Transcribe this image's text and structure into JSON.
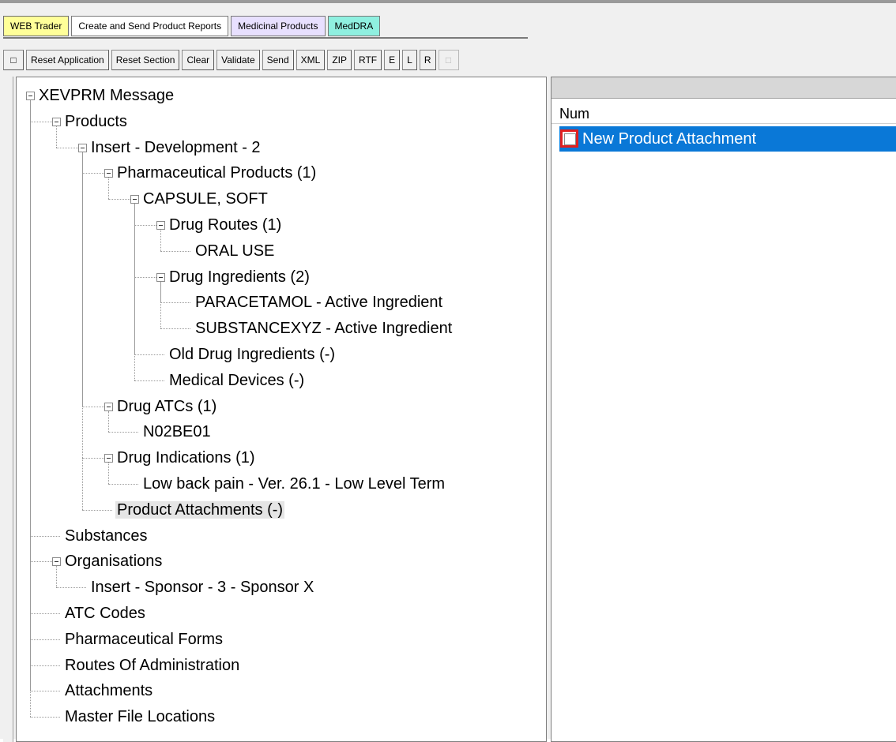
{
  "tabs": [
    {
      "label": "WEB Trader",
      "style": "yellow"
    },
    {
      "label": "Create and Send Product Reports",
      "style": "white"
    },
    {
      "label": "Medicinal Products",
      "style": "lav"
    },
    {
      "label": "MedDRA",
      "style": "teal"
    }
  ],
  "toolbar": {
    "checkbox_glyph": "□",
    "reset_application": "Reset Application",
    "reset_section": "Reset Section",
    "clear": "Clear",
    "validate": "Validate",
    "send": "Send",
    "xml": "XML",
    "zip": "ZIP",
    "rtf": "RTF",
    "e": "E",
    "l": "L",
    "r": "R",
    "disabled_glyph": "□"
  },
  "tree": {
    "nodes": [
      {
        "label": "XEVPRM Message",
        "level": 0,
        "expanded": true
      },
      {
        "label": "Products",
        "level": 1,
        "expanded": true
      },
      {
        "label": "Insert - Development - 2",
        "level": 2,
        "expanded": true
      },
      {
        "label": "Pharmaceutical Products (1)",
        "level": 3,
        "expanded": true
      },
      {
        "label": "CAPSULE, SOFT",
        "level": 4,
        "expanded": true
      },
      {
        "label": "Drug Routes (1)",
        "level": 5,
        "expanded": true
      },
      {
        "label": "ORAL USE",
        "level": 6
      },
      {
        "label": "Drug Ingredients (2)",
        "level": 5,
        "expanded": true
      },
      {
        "label": "PARACETAMOL - Active Ingredient",
        "level": 6
      },
      {
        "label": "SUBSTANCEXYZ - Active Ingredient",
        "level": 6
      },
      {
        "label": "Old Drug Ingredients (-)",
        "level": 5
      },
      {
        "label": "Medical Devices (-)",
        "level": 5
      },
      {
        "label": "Drug ATCs (1)",
        "level": 3,
        "expanded": true
      },
      {
        "label": "N02BE01",
        "level": 4
      },
      {
        "label": "Drug Indications (1)",
        "level": 3,
        "expanded": true
      },
      {
        "label": "Low back pain - Ver. 26.1 - Low Level Term",
        "level": 4
      },
      {
        "label": "Product Attachments (-)",
        "level": 3,
        "selected": true
      },
      {
        "label": "Substances",
        "level": 1
      },
      {
        "label": "Organisations",
        "level": 1,
        "expanded": true
      },
      {
        "label": "Insert - Sponsor - 3 - Sponsor X",
        "level": 2
      },
      {
        "label": "ATC Codes",
        "level": 1
      },
      {
        "label": "Pharmaceutical Forms",
        "level": 1
      },
      {
        "label": "Routes Of Administration",
        "level": 1
      },
      {
        "label": "Attachments",
        "level": 1
      },
      {
        "label": "Master File Locations",
        "level": 1
      }
    ]
  },
  "right_panel": {
    "column_header": "Num",
    "rows": [
      {
        "label": "New Product Attachment",
        "selected": true
      }
    ]
  }
}
